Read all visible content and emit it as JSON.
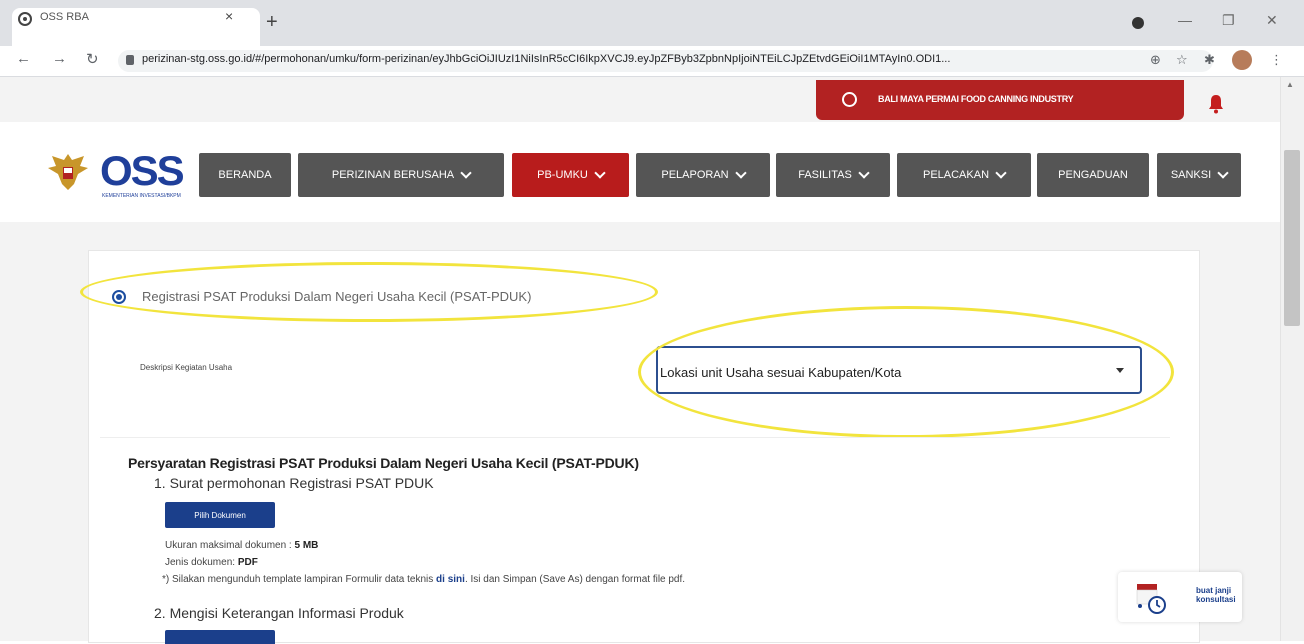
{
  "browser": {
    "tab_title": "OSS RBA",
    "tab_close": "×",
    "new_tab": "+",
    "url": "perizinan-stg.oss.go.id/#/permohonan/umku/form-perizinan/eyJhbGciOiJIUzI1NiIsInR5cCI6IkpXVCJ9.eyJpZFByb3ZpbnNpIjoiNTEiLCJpZEtvdGEiOiI1MTAyIn0.ODI1..."
  },
  "header": {
    "user_name": "BALI MAYA PERMAI FOOD CANNING INDUSTRY",
    "logo_text": "OSS",
    "logo_sub": "KEMENTERIAN INVESTASI/BKPM",
    "nav": [
      {
        "label": "BERANDA"
      },
      {
        "label": "PERIZINAN BERUSAHA"
      },
      {
        "label": "PB-UMKU"
      },
      {
        "label": "PELAPORAN"
      },
      {
        "label": "FASILITAS"
      },
      {
        "label": "PELACAKAN"
      },
      {
        "label": "PENGADUAN"
      },
      {
        "label": "SANKSI"
      }
    ],
    "active_nav": "PB-UMKU",
    "accent_color": "#b81c1c",
    "nav_color": "#555555"
  },
  "form": {
    "radio_label": "Registrasi PSAT Produksi Dalam Negeri Usaha Kecil (PSAT-PDUK)",
    "field_label": "Deskripsi Kegiatan Usaha",
    "select_value": "Lokasi unit Usaha sesuai Kabupaten/Kota",
    "requirements_title": "Persyaratan Registrasi PSAT Produksi Dalam Negeri Usaha Kecil (PSAT-PDUK)",
    "item1": "1. Surat permohonan Registrasi PSAT PDUK",
    "choose_doc": "Pilih Dokumen",
    "max_size_label": "Ukuran maksimal dokumen : ",
    "max_size": "5 MB",
    "doc_type_label": "Jenis dokumen: ",
    "doc_type": "PDF",
    "note_prefix": "*) Silakan mengunduh template lampiran Formulir data teknis ",
    "note_link": "di sini",
    "note_suffix": ". Isi dan Simpan (Save As) dengan format file pdf.",
    "item2": "2. Mengisi Keterangan Informasi Produk"
  },
  "consult": {
    "label": "buat janji konsultasi"
  },
  "annotation_color": "#f2e43d"
}
